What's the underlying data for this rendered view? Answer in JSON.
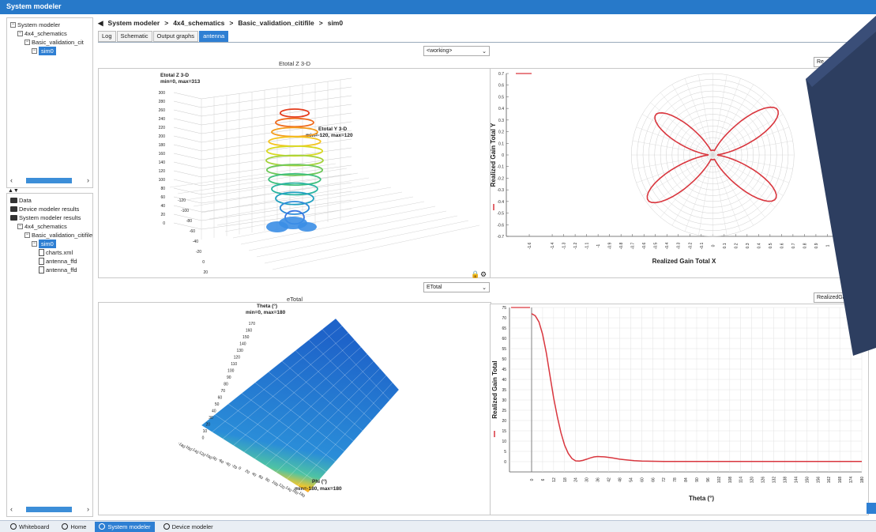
{
  "window": {
    "title": "System modeler"
  },
  "tree_top": {
    "items": [
      {
        "label": "System modeler",
        "level": 0
      },
      {
        "label": "4x4_schematics",
        "level": 1
      },
      {
        "label": "Basic_validation_cit",
        "level": 2
      },
      {
        "label": "sim0",
        "level": 3,
        "selected": true
      }
    ]
  },
  "tree_bottom": {
    "items": [
      {
        "label": "Data",
        "level": 0,
        "type": "folder"
      },
      {
        "label": "Device modeler results",
        "level": 0,
        "type": "folder"
      },
      {
        "label": "System modeler results",
        "level": 0,
        "type": "folder"
      },
      {
        "label": "4x4_schematics",
        "level": 1,
        "type": "node"
      },
      {
        "label": "Basic_validation_citifile",
        "level": 2,
        "type": "node"
      },
      {
        "label": "sim0",
        "level": 3,
        "type": "node",
        "selected": true
      },
      {
        "label": "charts.xml",
        "level": 4,
        "type": "doc"
      },
      {
        "label": "antenna_ffd",
        "level": 4,
        "type": "doc"
      },
      {
        "label": "antenna_ffd",
        "level": 4,
        "type": "doc"
      }
    ]
  },
  "breadcrumb": {
    "root": "System modeler",
    "sep": ">",
    "level1": "4x4_schematics",
    "level2": "Basic_validation_citifile",
    "level3": "sim0"
  },
  "tabs": [
    {
      "label": "Log"
    },
    {
      "label": "Schematic"
    },
    {
      "label": "Output graphs"
    },
    {
      "label": "antenna",
      "active": true
    }
  ],
  "working_select": {
    "value": "<working>"
  },
  "etotal_select": {
    "value": "ETotal"
  },
  "realized_btn_top": {
    "label": "Re"
  },
  "realized_btn_bottom": {
    "label": "RealizedGai"
  },
  "panel_3d_top": {
    "title": "Etotal Z 3-D",
    "axis_z_label": "Etotal Z 3-D",
    "axis_z_range": "min=0, max=313",
    "axis_y_label": "Etotal Y 3-D",
    "axis_y_range": "min=-120, max=120",
    "z_ticks": [
      "300",
      "280",
      "260",
      "240",
      "220",
      "200",
      "180",
      "160",
      "140",
      "120",
      "100",
      "80",
      "60",
      "40",
      "20",
      "0"
    ],
    "y_ticks": [
      "-120",
      "-100",
      "-80",
      "-60",
      "-40",
      "-20",
      "0",
      "20"
    ]
  },
  "panel_3d_bottom": {
    "title": "eTotal",
    "axis_theta_label": "Theta (°)",
    "axis_theta_range": "min=0, max=180",
    "axis_phi_label": "Phi (°)",
    "axis_phi_range": "min=-180, max=180",
    "theta_ticks": [
      "170",
      "160",
      "150",
      "140",
      "130",
      "120",
      "110",
      "100",
      "90",
      "80",
      "70",
      "60",
      "50",
      "40",
      "30",
      "20",
      "10",
      "0"
    ],
    "phi_ticks": [
      "-180",
      "-160",
      "-140",
      "-120",
      "-100",
      "-80",
      "-60",
      "-40",
      "-20",
      "0",
      "20",
      "40",
      "60",
      "80",
      "100",
      "120",
      "140",
      "160",
      "180"
    ]
  },
  "chart_data": [
    {
      "type": "scatter",
      "subtype": "polar-xy",
      "xlabel": "Realized Gain Total X",
      "ylabel": "Realized Gain Total Y",
      "xlim": [
        -1.8,
        1.3
      ],
      "ylim": [
        -0.7,
        0.7
      ],
      "y_ticks": [
        0.7,
        0.6,
        0.5,
        0.4,
        0.3,
        0.2,
        0.1,
        0,
        -0.1,
        -0.2,
        -0.3,
        -0.4,
        -0.5,
        -0.6,
        -0.7
      ],
      "x_ticks": [
        -1.6,
        -1.4,
        -1.3,
        -1.2,
        -1.1,
        -1,
        -0.9,
        -0.8,
        -0.7,
        -0.6,
        -0.5,
        -0.4,
        -0.3,
        -0.2,
        -0.1,
        0,
        0.1,
        0.2,
        0.3,
        0.4,
        0.5,
        0.6,
        0.7,
        0.8,
        0.9,
        1,
        1.1,
        1.2
      ],
      "series": [
        {
          "color": "#d9363e",
          "lobes": [
            {
              "angle_deg": 35,
              "r": 0.68
            },
            {
              "angle_deg": 145,
              "r": 0.6
            },
            {
              "angle_deg": 215,
              "r": 0.68
            },
            {
              "angle_deg": 325,
              "r": 0.66
            }
          ]
        }
      ],
      "grid": true
    },
    {
      "type": "line",
      "xlabel": "Theta (°)",
      "ylabel": "Realized Gain Total",
      "xlim": [
        0,
        180
      ],
      "ylim": [
        -5,
        75
      ],
      "y_ticks": [
        75,
        70,
        65,
        60,
        55,
        50,
        45,
        40,
        35,
        30,
        25,
        20,
        15,
        10,
        5,
        0
      ],
      "x_ticks": [
        0,
        6,
        12,
        18,
        24,
        30,
        36,
        42,
        48,
        54,
        60,
        66,
        72,
        78,
        84,
        90,
        96,
        102,
        108,
        114,
        120,
        126,
        132,
        138,
        144,
        150,
        156,
        162,
        168,
        174,
        180
      ],
      "series": [
        {
          "color": "#d9363e",
          "x": [
            0,
            2,
            4,
            6,
            8,
            10,
            12,
            14,
            16,
            18,
            20,
            22,
            24,
            26,
            28,
            30,
            32,
            34,
            36,
            40,
            44,
            48,
            52,
            56,
            60,
            66,
            72,
            90,
            120,
            150,
            180
          ],
          "values": [
            72,
            71,
            68,
            62,
            53,
            42,
            31,
            22,
            14,
            8,
            4,
            1.5,
            0.4,
            0.3,
            0.6,
            1.2,
            1.8,
            2.3,
            2.5,
            2.3,
            1.8,
            1.2,
            0.8,
            0.5,
            0.3,
            0.2,
            0.1,
            0.1,
            0.1,
            0.1,
            0.1
          ]
        }
      ],
      "grid": true
    }
  ],
  "statusbar": {
    "tabs": [
      {
        "label": "Whiteboard"
      },
      {
        "label": "Home"
      },
      {
        "label": "System modeler",
        "active": true
      },
      {
        "label": "Device modeler"
      }
    ]
  },
  "colors": {
    "accent": "#2e7fd3",
    "titlebar": "#2779c9",
    "series": "#d9363e"
  }
}
